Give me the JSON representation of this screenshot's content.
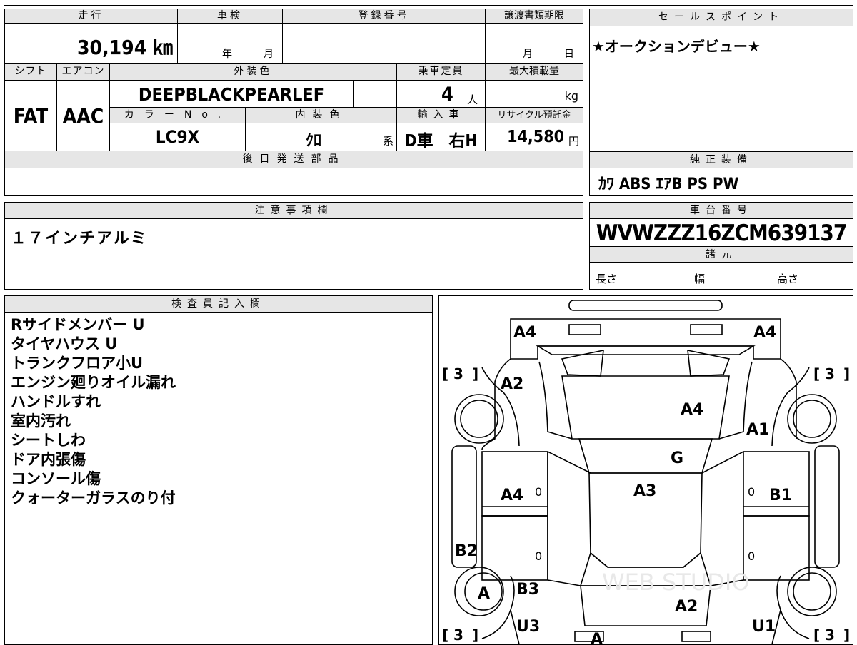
{
  "header_row": {
    "mileage_label": "走行",
    "inspection_label": "車検",
    "registration_label": "登録番号",
    "transfer_deadline_label": "譲渡書類期限",
    "mileage_value": "30,194 ㎞",
    "inspection_year_unit": "年",
    "inspection_month_unit": "月",
    "transfer_month_unit": "月",
    "transfer_day_unit": "日"
  },
  "spec_row": {
    "shift_label": "シフト",
    "aircon_label": "エアコン",
    "exterior_color_label": "外装色",
    "capacity_label": "乗車定員",
    "max_load_label": "最大積載量",
    "shift_value": "FAT",
    "aircon_value": "AAC",
    "exterior_color_value": "DEEPBLACKPEARLEF",
    "capacity_value": "4",
    "capacity_unit": "人",
    "max_load_unit": "kg",
    "color_no_label": "カラーNo.",
    "interior_color_label": "内装色",
    "import_label": "輸入車",
    "recycle_label": "リサイクル預託金",
    "color_no_value": "LC9X",
    "interior_color_value": "ｸﾛ",
    "interior_suffix": "系",
    "import_d": "D車",
    "import_h": "右H",
    "recycle_value": "14,580",
    "recycle_unit": "円"
  },
  "later_parts": {
    "label": "後日発送部品",
    "value": ""
  },
  "sales_point": {
    "label": "セールスポイント",
    "text": "★オークションデビュー★"
  },
  "genuine_equipment": {
    "label": "純正装備",
    "text": "ｶﾜ ABS ｴｱB PS PW"
  },
  "caution": {
    "label": "注意事項欄",
    "text": "１７インチアルミ"
  },
  "chassis": {
    "label": "車台番号",
    "value": "WVWZZZ16ZCM639137"
  },
  "dimensions": {
    "label": "諸元",
    "length_label": "長さ",
    "width_label": "幅",
    "height_label": "高さ"
  },
  "inspector": {
    "label": "検査員記入欄",
    "notes": [
      "Rサイドメンバー U",
      "タイヤハウス U",
      "トランクフロア小U",
      "エンジン廻りオイル漏れ",
      "ハンドルすれ",
      "室内汚れ",
      "シートしわ",
      "ドア内張傷",
      "コンソール傷",
      "クォーターガラスのり付"
    ]
  },
  "diagram": {
    "marks": {
      "front_left": "A4",
      "front_right": "A4",
      "hood_left": "A2",
      "hood": "A4",
      "fender_right": "A1",
      "windshield": "G",
      "roof": "A3",
      "door_front_left": "A4",
      "door_front_right": "B1",
      "door_rear_left": "B2",
      "rear_wheel_left": "A",
      "rear_left": "B3",
      "trunk": "A2",
      "rear_bumper_left": "U3",
      "rear_bumper_right": "U1",
      "rear_center": "A"
    },
    "tire_labels": {
      "front_left": "3",
      "front_right": "3",
      "rear_left": "3",
      "rear_right": "3"
    },
    "zeros": [
      "0",
      "0",
      "0",
      "0"
    ],
    "watermark": "WEB STUDIO"
  }
}
